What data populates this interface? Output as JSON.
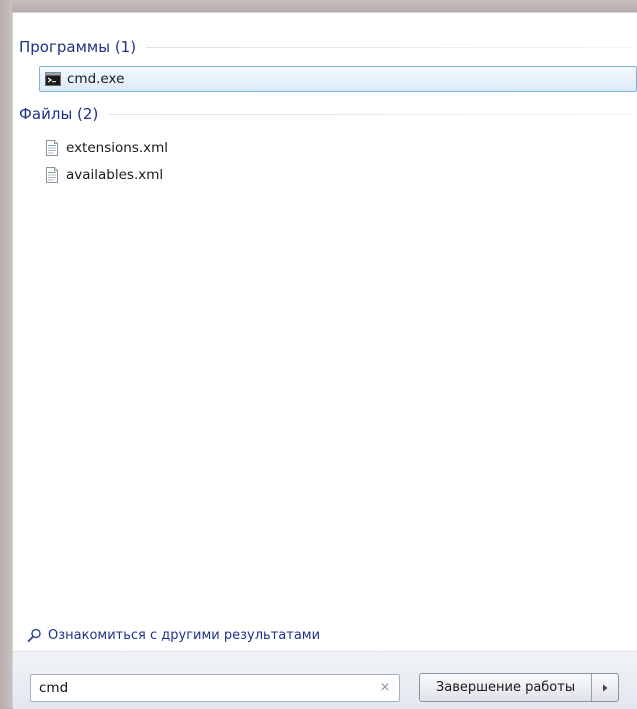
{
  "groups": [
    {
      "title": "Программы (1)",
      "items": [
        {
          "label": "cmd.exe",
          "icon": "cmd-icon",
          "selected": true
        }
      ]
    },
    {
      "title": "Файлы (2)",
      "items": [
        {
          "label": "extensions.xml",
          "icon": "xml-file-icon",
          "selected": false
        },
        {
          "label": "availables.xml",
          "icon": "xml-file-icon",
          "selected": false
        }
      ]
    }
  ],
  "more_results": {
    "label": "Ознакомиться с другими результатами",
    "icon": "search-icon"
  },
  "search": {
    "value": "cmd",
    "clear_icon": "×"
  },
  "shutdown": {
    "label": "Завершение работы",
    "arrow_icon": "chevron-right-icon"
  },
  "colors": {
    "heading": "#1e3287",
    "selection_border": "#7eb0e0",
    "selection_fill": "#dbeaf8"
  }
}
